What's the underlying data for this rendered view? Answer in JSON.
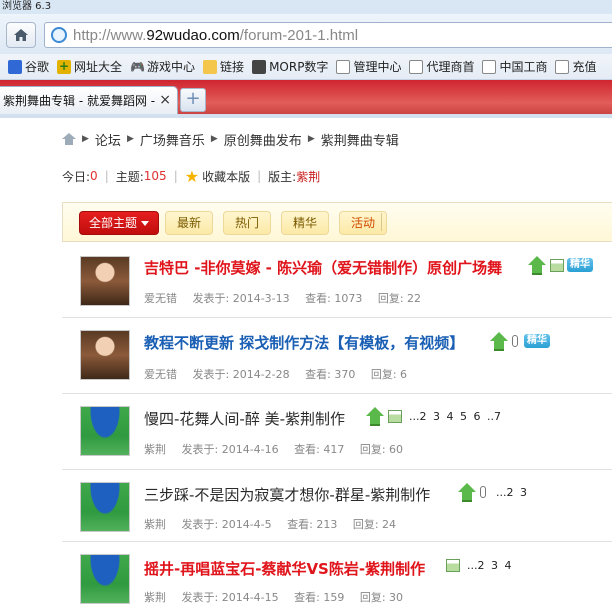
{
  "window": {
    "title": "浏览器 6.3"
  },
  "address": {
    "prefix": "http://www.",
    "host": "92wudao.com",
    "path": "/forum-201-1.html"
  },
  "bookmarks": [
    {
      "label": "谷歌",
      "icon": "baidu-icon"
    },
    {
      "label": "网址大全",
      "icon": "plus-icon"
    },
    {
      "label": "游戏中心",
      "icon": "gamepad-icon"
    },
    {
      "label": "链接",
      "icon": "folder-icon"
    },
    {
      "label": "MORP数字",
      "icon": "morp-icon"
    },
    {
      "label": "管理中心",
      "icon": "page-icon"
    },
    {
      "label": "代理商首",
      "icon": "page-icon"
    },
    {
      "label": "中国工商",
      "icon": "page-icon"
    },
    {
      "label": "充值",
      "icon": "page-icon"
    }
  ],
  "tab": {
    "title": "紫荆舞曲专辑 - 就爱舞蹈网 -",
    "close": "×",
    "new": "+"
  },
  "breadcrumb": [
    "论坛",
    "广场舞音乐",
    "原创舞曲发布",
    "紫荆舞曲专辑"
  ],
  "stats": {
    "today_label": "今日:",
    "today_value": "0",
    "topics_label": "主题:",
    "topics_value": "105",
    "favorite_label": "收藏本版",
    "moderator_label": "版主:",
    "moderator_value": "紫荆"
  },
  "filters": {
    "all": "全部主题",
    "new": "最新",
    "hot": "热门",
    "digest": "精华",
    "event": "活动"
  },
  "threads": [
    {
      "title": "吉特巴 -非你莫嫁 - 陈兴瑜（爱无错制作）原创广场舞",
      "style": "red",
      "author": "爱无错",
      "posted": "发表于: 2014-3-13",
      "views": "查看: 1073",
      "replies": "回复: 22",
      "digest": "精华",
      "pages": ""
    },
    {
      "title": "教程不断更新 探戈制作方法【有模板，有视频】",
      "style": "blue",
      "author": "爱无错",
      "posted": "发表于: 2014-2-28",
      "views": "查看: 370",
      "replies": "回复: 6",
      "digest": "精华",
      "pages": ""
    },
    {
      "title": "慢四-花舞人间-醉 美-紫荆制作",
      "style": "normal",
      "author": "紫荆",
      "posted": "发表于: 2014-4-16",
      "views": "查看: 417",
      "replies": "回复: 60",
      "digest": "",
      "pages": "...2 3 4 5 6 ..7"
    },
    {
      "title": "三步踩-不是因为寂寞才想你-群星-紫荆制作",
      "style": "normal",
      "author": "紫荆",
      "posted": "发表于: 2014-4-5",
      "views": "查看: 213",
      "replies": "回复: 24",
      "digest": "",
      "pages": "...2 3"
    },
    {
      "title": "摇井-再唱蓝宝石-蔡献华VS陈岩-紫荆制作",
      "style": "red",
      "author": "紫荆",
      "posted": "发表于: 2014-4-15",
      "views": "查看: 159",
      "replies": "回复: 30",
      "digest": "",
      "pages": "...2 3 4"
    }
  ]
}
